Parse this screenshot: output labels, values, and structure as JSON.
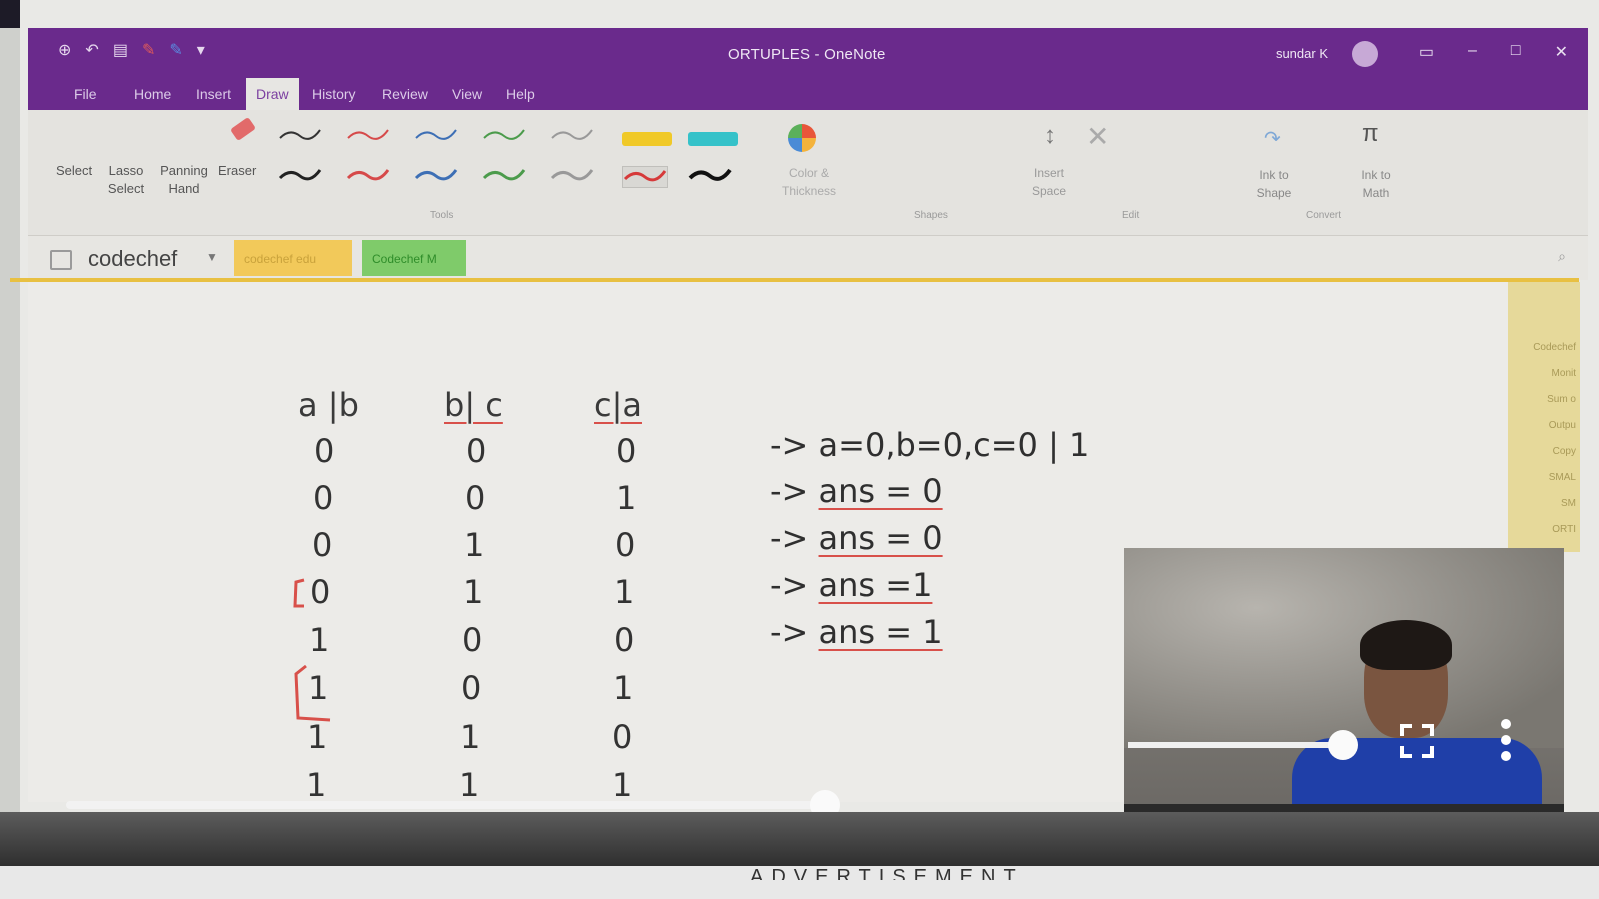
{
  "titlebar": {
    "title": "ORTUPLES - OneNote",
    "user": "sundar K"
  },
  "tabs": [
    {
      "label": "File"
    },
    {
      "label": "Home"
    },
    {
      "label": "Insert"
    },
    {
      "label": "Draw"
    },
    {
      "label": "History"
    },
    {
      "label": "Review"
    },
    {
      "label": "View"
    },
    {
      "label": "Help"
    }
  ],
  "ribbon": {
    "tools": {
      "select": "Select",
      "lasso": "Lasso Select",
      "panning": "Panning Hand",
      "eraser": "Eraser",
      "group": "Tools"
    },
    "color_thickness": "Color & Thickness",
    "shapes_group": "Shapes",
    "insert_space": "Insert Space",
    "edit_group": "Edit",
    "ink_to_shape": "Ink to Shape",
    "ink_to_math": "Ink to Math",
    "convert_group": "Convert"
  },
  "notebook": {
    "name": "codechef",
    "sections": [
      "codechef edu",
      "Codechef M"
    ]
  },
  "right_pane": [
    "Codechef",
    "Monit",
    "Sum o",
    "Outpu",
    "Copy",
    "SMAL",
    "SM",
    "ORTI"
  ],
  "table": {
    "headers": [
      "a |b",
      "b| c",
      "c|a"
    ],
    "rows": [
      [
        "0",
        "0",
        "0"
      ],
      [
        "0",
        "0",
        "1"
      ],
      [
        "0",
        "1",
        "0"
      ],
      [
        "0",
        "1",
        "1"
      ],
      [
        "1",
        "0",
        "0"
      ],
      [
        "1",
        "0",
        "1"
      ],
      [
        "1",
        "1",
        "0"
      ],
      [
        "1",
        "1",
        "1"
      ]
    ]
  },
  "notes": [
    {
      "arrow": "->",
      "text": "a=0,b=0,c=0  | 1"
    },
    {
      "arrow": "->",
      "text": "ans = 0"
    },
    {
      "arrow": "->",
      "text": "ans = 0"
    },
    {
      "arrow": "->",
      "text": "ans =1"
    },
    {
      "arrow": "->",
      "text": "ans = 1"
    }
  ],
  "video": {
    "progress": 0.55,
    "ad_label": "ADVERTISEMENT"
  },
  "colors": {
    "onenote_purple": "#6a2a8c",
    "section_yellow": "#f2c95a",
    "section_green": "#7fcb6a",
    "ink_red": "#d8504a"
  }
}
